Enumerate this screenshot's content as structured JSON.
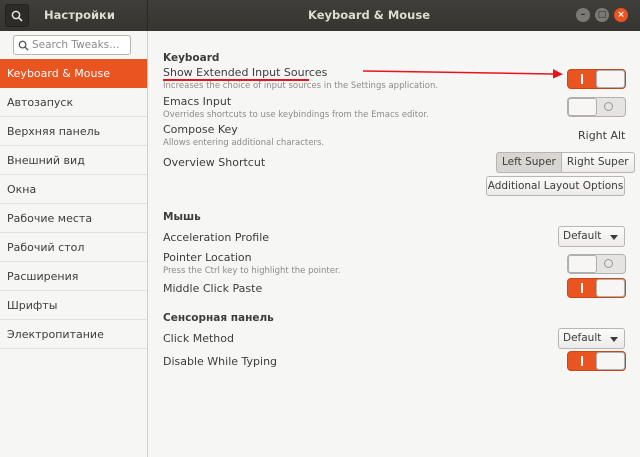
{
  "app": {
    "title": "Настройки",
    "window_title": "Keyboard & Mouse"
  },
  "window_controls": {
    "minimize": "–",
    "maximize": "□",
    "close": "×"
  },
  "search": {
    "placeholder": "Search Tweaks…"
  },
  "sidebar": {
    "items": [
      {
        "label": "Keyboard & Mouse",
        "active": true
      },
      {
        "label": "Автозапуск"
      },
      {
        "label": "Верхняя панель"
      },
      {
        "label": "Внешний вид"
      },
      {
        "label": "Окна"
      },
      {
        "label": "Рабочие места"
      },
      {
        "label": "Рабочий стол"
      },
      {
        "label": "Расширения"
      },
      {
        "label": "Шрифты"
      },
      {
        "label": "Электропитание"
      }
    ]
  },
  "keyboard": {
    "section": "Keyboard",
    "extended_sources": {
      "label": "Show Extended Input Sources",
      "desc": "Increases the choice of input sources in the Settings application.",
      "state": "on"
    },
    "emacs": {
      "label": "Emacs Input",
      "desc": "Overrides shortcuts to use keybindings from the Emacs editor.",
      "state": "off"
    },
    "compose": {
      "label": "Compose Key",
      "desc": "Allows entering additional characters.",
      "value": "Right Alt"
    },
    "overview": {
      "label": "Overview Shortcut",
      "options": [
        "Left Super",
        "Right Super"
      ],
      "selected": "Left Super"
    },
    "additional_layout": "Additional Layout Options"
  },
  "mouse": {
    "section": "Мышь",
    "accel": {
      "label": "Acceleration Profile",
      "value": "Default"
    },
    "pointer_location": {
      "label": "Pointer Location",
      "desc": "Press the Ctrl key to highlight the pointer.",
      "state": "off"
    },
    "middle_click": {
      "label": "Middle Click Paste",
      "state": "on"
    }
  },
  "touchpad": {
    "section": "Сенсорная панель",
    "click_method": {
      "label": "Click Method",
      "value": "Default"
    },
    "disable_typing": {
      "label": "Disable While Typing",
      "state": "on"
    }
  },
  "colors": {
    "accent": "#e95420",
    "annotation": "#e8141b",
    "titlebar": "#3c3b37"
  }
}
